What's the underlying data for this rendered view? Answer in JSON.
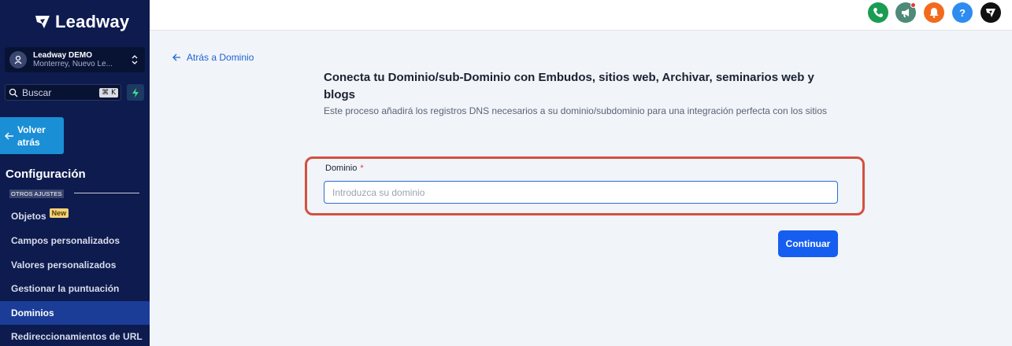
{
  "brand": {
    "name": "Leadway"
  },
  "account": {
    "name": "Leadway DEMO",
    "location": "Monterrey, Nuevo Le..."
  },
  "search": {
    "label": "Buscar",
    "shortcut": "⌘ K"
  },
  "sidebar": {
    "back_label": "Volver atrás",
    "section_title": "Configuración",
    "subheading": "OTROS AJUSTES",
    "items": [
      {
        "label": "Objetos",
        "badge": "New"
      },
      {
        "label": "Campos personalizados"
      },
      {
        "label": "Valores personalizados"
      },
      {
        "label": "Gestionar la puntuación"
      },
      {
        "label": "Dominios",
        "active": true
      },
      {
        "label": "Redireccionamientos de URL"
      }
    ]
  },
  "topbar": {
    "icons": [
      {
        "name": "phone-icon",
        "color": "#1a9c52"
      },
      {
        "name": "megaphone-icon",
        "color": "#4f8a78"
      },
      {
        "name": "bell-icon",
        "color": "#f26b1d"
      },
      {
        "name": "help-icon",
        "color": "#2d8cf0"
      },
      {
        "name": "brand-icon",
        "color": "#111111"
      }
    ]
  },
  "main": {
    "back_link": "Atrás a Dominio",
    "title": "Conecta tu Dominio/sub-Dominio con Embudos, sitios web, Archivar, seminarios web y blogs",
    "description": "Este proceso añadirá los registros DNS necesarios a su dominio/subdominio para una integración perfecta con los sitios",
    "field": {
      "label": "Dominio",
      "required_mark": "*",
      "placeholder": "Introduzca su dominio",
      "value": ""
    },
    "continue_label": "Continuar"
  },
  "colors": {
    "sidebar_bg": "#0d1b4f",
    "accent": "#155eef",
    "highlight": "#d2513f"
  }
}
